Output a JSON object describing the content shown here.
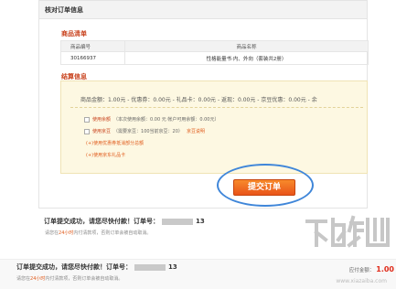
{
  "panel": {
    "header": "核对订单信息",
    "items_title": "商品清单",
    "settle_title": "结算信息"
  },
  "items_table": {
    "headers": [
      "商品编号",
      "商品名称"
    ],
    "rows": [
      [
        "30166937",
        "性格能量书·内、外向（套装共2册）"
      ]
    ]
  },
  "settlement": {
    "amounts": "商品金额：1.00元 - 优惠券：0.00元 - 礼品卡：0.00元 - 返现：0.00元 - 京豆优惠：0.00元 - 余",
    "balance_label": "使用余额",
    "balance_text": "（本次使用余额：0.00 元 帐户可用余额：0.00元）",
    "jingdou_label": "使用京豆",
    "jingdou_text": "（需要京豆：100当前京豆：20）",
    "jingdou_link": "京豆说明",
    "coupon_link": "(+)使用优惠券抵消部分总额",
    "giftcard_link": "(+)使用京东礼品卡"
  },
  "submit_label": "提交订单",
  "result": {
    "title_prefix": "订单提交成功，请您尽快付款！订单号：",
    "order_tail": "13",
    "note_prefix": "请您在",
    "note_hl": "24小时",
    "note_suffix": "内付清款项，否则订单会被自动取消。",
    "pay_label": "应付金额：",
    "pay_value": "1.00"
  },
  "watermark": {
    "caption": "www.xiazaiba.com"
  },
  "colors": {
    "accent": "#e9541a",
    "section_title": "#c8401b",
    "highlight_ring": "#3f86d9",
    "settle_bg": "#fdf8e2"
  }
}
